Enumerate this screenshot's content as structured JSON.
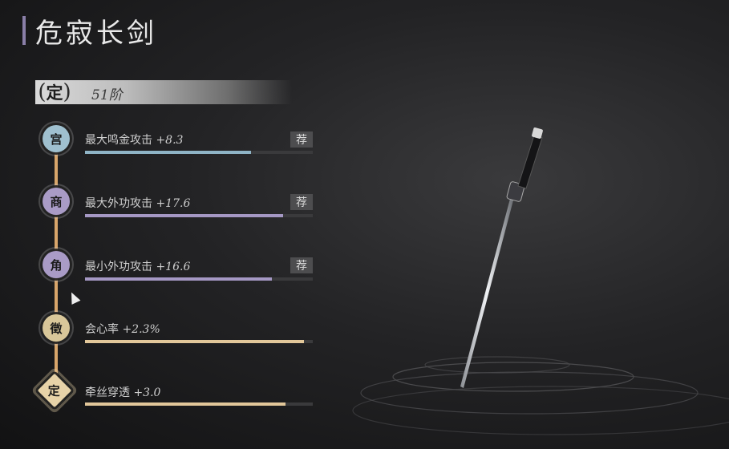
{
  "title": "危寂长剑",
  "tier": {
    "badge": "定",
    "level": "51阶"
  },
  "stats": [
    {
      "note": "宫",
      "label": "最大鸣金攻击",
      "value": "+8.3",
      "recommended": "荐",
      "fill": 0.73,
      "color": "#8fb4c6"
    },
    {
      "note": "商",
      "label": "最大外功攻击",
      "value": "+17.6",
      "recommended": "荐",
      "fill": 0.87,
      "color": "#a598c4"
    },
    {
      "note": "角",
      "label": "最小外功攻击",
      "value": "+16.6",
      "recommended": "荐",
      "fill": 0.82,
      "color": "#a598c4"
    },
    {
      "note": "徵",
      "label": "会心率",
      "value": "+2.3%",
      "recommended": "",
      "fill": 0.96,
      "color": "#e2c79a"
    },
    {
      "note": "定",
      "label": "牵丝穿透",
      "value": "+3.0",
      "recommended": "",
      "fill": 0.88,
      "color": "#e2c79a"
    }
  ]
}
